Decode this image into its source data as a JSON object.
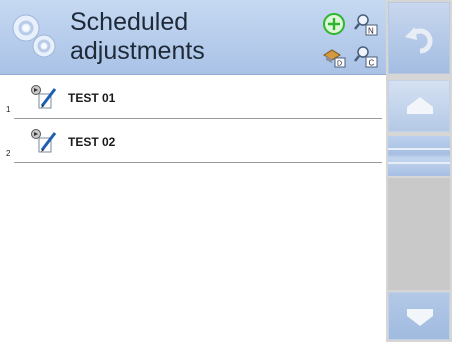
{
  "header": {
    "title": "Scheduled adjustments",
    "logo_icon": "gears-icon",
    "buttons": [
      {
        "name": "add-button",
        "icon": "plus-circle-icon"
      },
      {
        "name": "search-by-name-button",
        "icon": "magnifier-n-icon",
        "letter": "N"
      },
      {
        "name": "filter-button",
        "icon": "paint-filter-icon",
        "letter": "D"
      },
      {
        "name": "search-by-code-button",
        "icon": "magnifier-c-icon",
        "letter": "C"
      }
    ]
  },
  "navigation": {
    "back_icon": "undo-arrow-icon",
    "up_icon": "up-arrow-icon",
    "down_icon": "down-arrow-icon"
  },
  "list": {
    "items": [
      {
        "index": "1",
        "label": "TEST 01",
        "icon": "calibration-edit-icon"
      },
      {
        "index": "2",
        "label": "TEST 02",
        "icon": "calibration-edit-icon"
      }
    ]
  },
  "colors": {
    "header_bg": "#b7cdec",
    "accent_blue": "#a3bde2",
    "rail_bg": "#d6d6d6",
    "add_green": "#2fb52f"
  }
}
